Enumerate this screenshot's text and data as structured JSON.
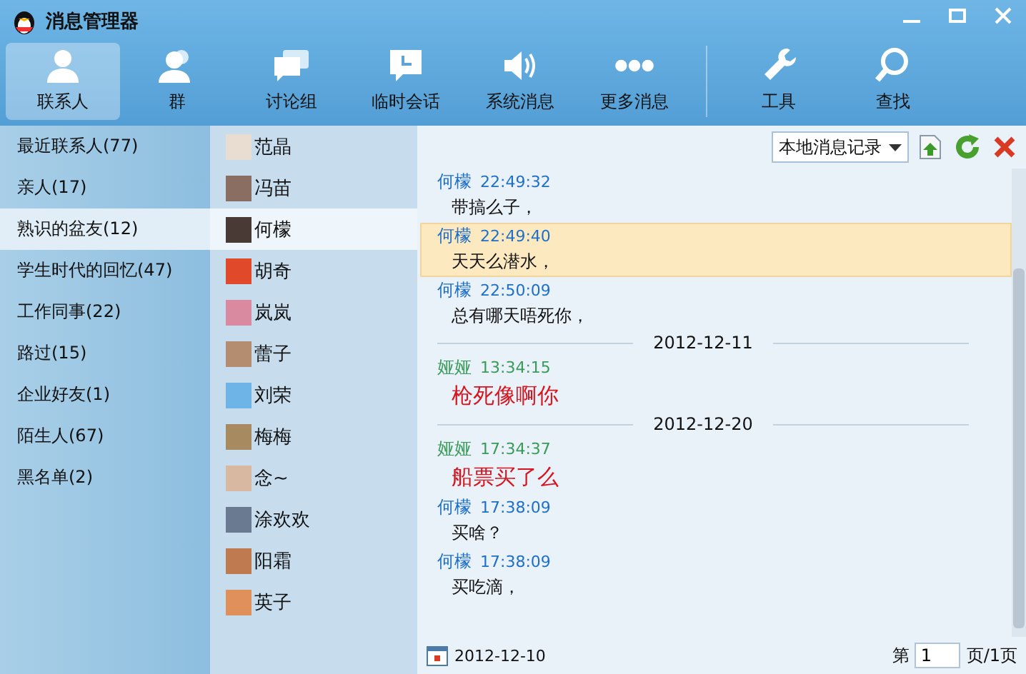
{
  "window": {
    "title": "消息管理器"
  },
  "toolbar": [
    {
      "label": "联系人",
      "kind": "contact",
      "selected": true
    },
    {
      "label": "群",
      "kind": "group",
      "selected": false
    },
    {
      "label": "讨论组",
      "kind": "discussion",
      "selected": false
    },
    {
      "label": "临时会话",
      "kind": "temp",
      "selected": false
    },
    {
      "label": "系统消息",
      "kind": "system",
      "selected": false
    },
    {
      "label": "更多消息",
      "kind": "more",
      "selected": false
    },
    {
      "label": "工具",
      "kind": "tools",
      "selected": false
    },
    {
      "label": "查找",
      "kind": "search",
      "selected": false
    }
  ],
  "groups": [
    {
      "label": "最近联系人(77)",
      "selected": false
    },
    {
      "label": "亲人(17)",
      "selected": false
    },
    {
      "label": "熟识的盆友(12)",
      "selected": true
    },
    {
      "label": "学生时代的回忆(47)",
      "selected": false
    },
    {
      "label": "工作同事(22)",
      "selected": false
    },
    {
      "label": "路过(15)",
      "selected": false
    },
    {
      "label": "企业好友(1)",
      "selected": false
    },
    {
      "label": "陌生人(67)",
      "selected": false
    },
    {
      "label": "黑名单(2)",
      "selected": false
    }
  ],
  "contacts": [
    {
      "name": "范晶",
      "selected": false
    },
    {
      "name": "冯苗",
      "selected": false
    },
    {
      "name": "何檬",
      "selected": true
    },
    {
      "name": "胡奇",
      "selected": false
    },
    {
      "name": "岚岚",
      "selected": false
    },
    {
      "name": "蕾子",
      "selected": false
    },
    {
      "name": "刘荣",
      "selected": false
    },
    {
      "name": "梅梅",
      "selected": false
    },
    {
      "name": "念~",
      "selected": false
    },
    {
      "name": "涂欢欢",
      "selected": false
    },
    {
      "name": "阳霜",
      "selected": false
    },
    {
      "name": "英子",
      "selected": false
    }
  ],
  "history": {
    "source": "本地消息记录",
    "messages": [
      {
        "kind": "message",
        "sender": "何檬",
        "time": "22:49:32",
        "text": "带搞么子，",
        "from_self": false,
        "selected": false
      },
      {
        "kind": "message",
        "sender": "何檬",
        "time": "22:49:40",
        "text": "天天么潜水，",
        "from_self": false,
        "selected": true
      },
      {
        "kind": "message",
        "sender": "何檬",
        "time": "22:50:09",
        "text": "总有哪天唔死你，",
        "from_self": false,
        "selected": false
      },
      {
        "kind": "date",
        "text": "2012-12-11"
      },
      {
        "kind": "message",
        "sender": "娅娅",
        "time": "13:34:15",
        "text": "枪死像啊你",
        "from_self": true,
        "selected": false
      },
      {
        "kind": "date",
        "text": "2012-12-20"
      },
      {
        "kind": "message",
        "sender": "娅娅",
        "time": "17:34:37",
        "text": "船票买了么",
        "from_self": true,
        "selected": false
      },
      {
        "kind": "message",
        "sender": "何檬",
        "time": "17:38:09",
        "text": "买啥？",
        "from_self": false,
        "selected": false
      },
      {
        "kind": "message",
        "sender": "何檬",
        "time": "17:38:09",
        "text": "买吃滴，",
        "from_self": false,
        "selected": false
      }
    ],
    "date": "2012-12-10",
    "page_prefix": "第",
    "page": "1",
    "page_suffix": "页/1页"
  }
}
